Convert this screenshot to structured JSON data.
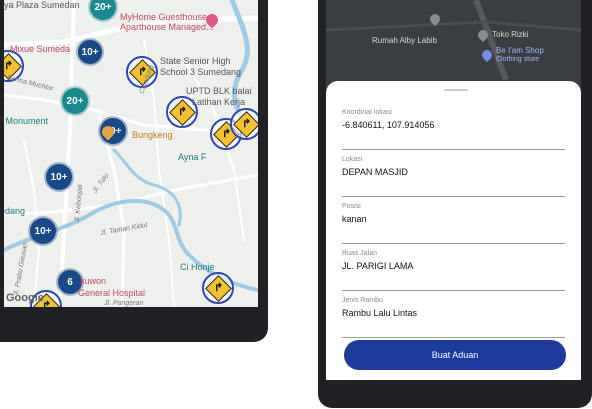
{
  "left_map": {
    "clusters": [
      {
        "label": "20+",
        "color": "teal"
      },
      {
        "label": "10+",
        "color": "teal"
      },
      {
        "label": "20+",
        "color": "teal"
      },
      {
        "label": "10+",
        "color": "blue"
      },
      {
        "label": "10+",
        "color": "blue"
      },
      {
        "label": "10+",
        "color": "blue"
      },
      {
        "label": "6",
        "color": "blue"
      }
    ],
    "places": {
      "hotel_line1": "MyHome Guesthouse",
      "hotel_line2": "Aparthouse Managed...",
      "plaza": "iya Plaza Sumedan",
      "mixue": "Mixue Sumeda",
      "school_line1": "State Senior High",
      "school_line2": "School 3 Sumedang",
      "blk_line1": "UPTD BLK balai",
      "blk_line2": "Latihan Kerja",
      "monument": "g Monument",
      "bungkeng": "Bungkeng",
      "ayna": "Ayna F",
      "edang": "edang",
      "cihonje": "Ci Honje",
      "hospital_line1": "kuwon",
      "hospital_line2": "General Hospital",
      "google": "Google"
    },
    "roads": {
      "serma": "Serma Muchtar",
      "cipadung": "Cipadung",
      "kebonjati": "Jl. Kebonjati",
      "jl_tulu": "Jl. Tulu",
      "kidul": "Jl. Taman Kidul",
      "prabu": "Jl. Prabu Geusan",
      "pangeran": "Jl. Pangeran"
    }
  },
  "right_map": {
    "place_1": "Rumah Alby Labib",
    "place_2": "Toko Rizki",
    "place_3_line1": "Be I'am Shop",
    "place_3_line2": "Clothing store"
  },
  "form": {
    "fields": [
      {
        "label": "Koordinat lokasi",
        "value": "-6.840611, 107.914056"
      },
      {
        "label": "Lokasi",
        "value": "DEPAN MASJID"
      },
      {
        "label": "Posisi",
        "value": "kanan"
      },
      {
        "label": "Ruas Jalan",
        "value": "JL. PARIGI LAMA"
      },
      {
        "label": "Jenis Rambu",
        "value": "Rambu Lalu Lintas"
      }
    ],
    "submit_label": "Buat Aduan"
  },
  "colors": {
    "teal_cluster": "#1a8a8f",
    "blue_cluster": "#174a86",
    "sign_border": "#2a46b8",
    "sign_fill": "#f2c230",
    "button": "#1d3a9f"
  }
}
